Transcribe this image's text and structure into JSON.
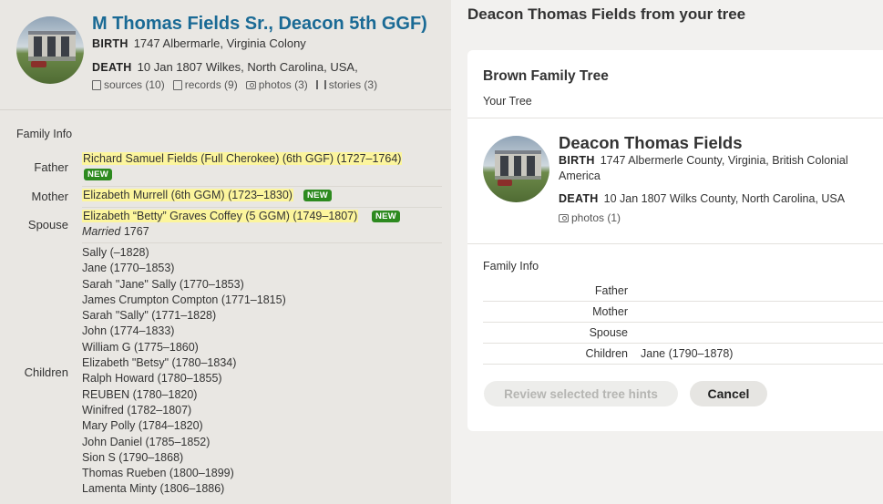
{
  "left": {
    "title": "M Thomas Fields Sr., Deacon 5th GGF)",
    "birth_label": "BIRTH",
    "birth_value": "1747 Albermarle, Virginia Colony",
    "death_label": "DEATH",
    "death_value": "10 Jan 1807 Wilkes, North Carolina, USA,",
    "meta": {
      "sources": "sources (10)",
      "records": "records (9)",
      "photos": "photos (3)",
      "stories": "stories (3)"
    },
    "family_info_label": "Family Info",
    "father_label": "Father",
    "father_value": "Richard Samuel Fields (Full Cherokee) (6th GGF) (1727–1764)",
    "mother_label": "Mother",
    "mother_value": "Elizabeth Murrell (6th GGM) (1723–1830)",
    "spouse_label": "Spouse",
    "spouse_value": "Elizabeth “Betty” Graves Coffey (5 GGM) (1749–1807)",
    "married_label": "Married",
    "married_year": "1767",
    "new_badge": "NEW",
    "children_label": "Children",
    "children": [
      "Sally (–1828)",
      "Jane (1770–1853)",
      "Sarah \"Jane\" Sally (1770–1853)",
      "James Crumpton Compton (1771–1815)",
      "Sarah \"Sally\" (1771–1828)",
      "John (1774–1833)",
      "William G (1775–1860)",
      "Elizabeth \"Betsy\" (1780–1834)",
      "Ralph Howard (1780–1855)",
      "REUBEN (1780–1820)",
      "Winifred (1782–1807)",
      "Mary Polly (1784–1820)",
      "John Daniel (1785–1852)",
      "Sion S (1790–1868)",
      "Thomas Rueben (1800–1899)",
      "Lamenta Minty (1806–1886)"
    ]
  },
  "right": {
    "title": "Deacon Thomas Fields from your tree",
    "tree_name": "Brown Family Tree",
    "your_tree": "Your Tree",
    "person_name": "Deacon Thomas Fields",
    "birth_label": "BIRTH",
    "birth_value": "1747 Albermerle County, Virginia, British Colonial America",
    "death_label": "DEATH",
    "death_value": "10 Jan 1807 Wilks County, North Carolina, USA",
    "photos": "photos (1)",
    "family_info_label": "Family Info",
    "father_label": "Father",
    "mother_label": "Mother",
    "spouse_label": "Spouse",
    "children_label": "Children",
    "children_value": "Jane (1790–1878)",
    "review_button": "Review selected tree hints",
    "cancel_button": "Cancel"
  }
}
